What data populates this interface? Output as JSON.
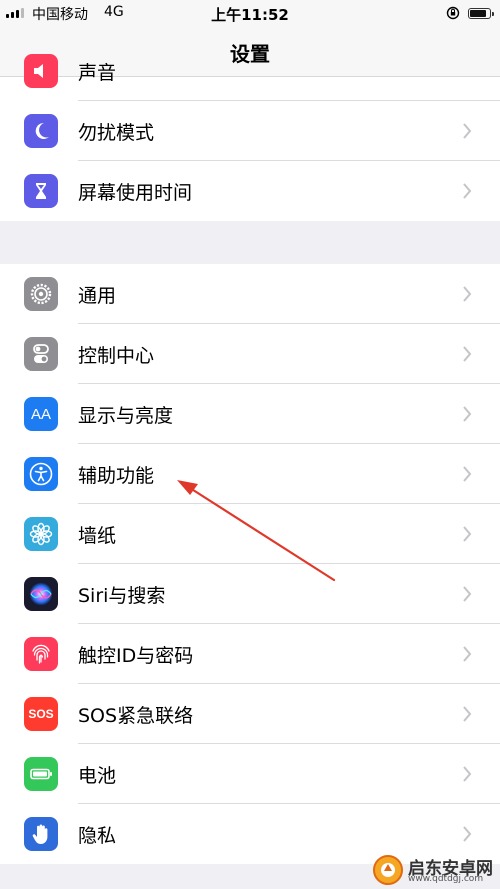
{
  "status_bar": {
    "carrier": "中国移动",
    "network": "4G",
    "time": "上午11:52"
  },
  "nav": {
    "title": "设置"
  },
  "groups": [
    {
      "rows": [
        {
          "label": "声音",
          "icon": "sound-icon",
          "color": "#ff3b5c"
        },
        {
          "label": "勿扰模式",
          "icon": "moon-icon",
          "color": "#5e5ce6"
        },
        {
          "label": "屏幕使用时间",
          "icon": "hourglass-icon",
          "color": "#5e5ce6"
        }
      ]
    },
    {
      "rows": [
        {
          "label": "通用",
          "icon": "gear-icon",
          "color": "#8e8e93"
        },
        {
          "label": "控制中心",
          "icon": "toggle-icon",
          "color": "#8e8e93"
        },
        {
          "label": "显示与亮度",
          "icon": "text-size-icon",
          "color": "#1e7cf2"
        },
        {
          "label": "辅助功能",
          "icon": "accessibility-icon",
          "color": "#1e7cf2"
        },
        {
          "label": "墙纸",
          "icon": "flower-icon",
          "color": "#35aadc"
        },
        {
          "label": "Siri与搜索",
          "icon": "siri-icon",
          "color": "#1a1a2e"
        },
        {
          "label": "触控ID与密码",
          "icon": "fingerprint-icon",
          "color": "#ff3b5c"
        },
        {
          "label": "SOS紧急联络",
          "icon": "sos-icon",
          "color": "#ff3b30"
        },
        {
          "label": "电池",
          "icon": "battery-icon",
          "color": "#34c759"
        },
        {
          "label": "隐私",
          "icon": "hand-icon",
          "color": "#2f6bd9"
        }
      ]
    }
  ],
  "icon_text": {
    "text_size": "AA",
    "sos": "SOS"
  },
  "watermark": {
    "name": "启东安卓网",
    "url": "www.qdtdgj.com"
  },
  "colors": {
    "background": "#efeff4",
    "annotation_arrow": "#e0382b"
  }
}
